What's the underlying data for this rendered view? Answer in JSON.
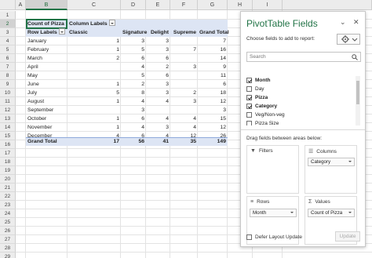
{
  "columns": [
    "A",
    "B",
    "C",
    "D",
    "E",
    "F",
    "G",
    "H",
    "I"
  ],
  "rows": [
    "1",
    "2",
    "3",
    "4",
    "5",
    "6",
    "7",
    "8",
    "9",
    "10",
    "11",
    "12",
    "13",
    "14",
    "15",
    "16",
    "17",
    "18",
    "19",
    "20",
    "21",
    "22",
    "23",
    "24",
    "25",
    "26",
    "27",
    "28",
    "29"
  ],
  "selected_column": "B",
  "selected_row": "2",
  "pivot": {
    "values_label": "Count of Pizza",
    "column_labels": "Column Labels",
    "row_labels": "Row Labels",
    "headers": [
      "Classic",
      "Signature",
      "Delight",
      "Supreme",
      "Grand Total"
    ],
    "data_rows": [
      {
        "label": "January",
        "vals": [
          "1",
          "3",
          "3",
          "",
          "7"
        ]
      },
      {
        "label": "February",
        "vals": [
          "1",
          "5",
          "3",
          "7",
          "16"
        ]
      },
      {
        "label": "March",
        "vals": [
          "2",
          "6",
          "6",
          "",
          "14"
        ]
      },
      {
        "label": "April",
        "vals": [
          "",
          "4",
          "2",
          "3",
          "9"
        ]
      },
      {
        "label": "May",
        "vals": [
          "",
          "5",
          "6",
          "",
          "11"
        ]
      },
      {
        "label": "June",
        "vals": [
          "1",
          "2",
          "3",
          "",
          "6"
        ]
      },
      {
        "label": "July",
        "vals": [
          "5",
          "8",
          "3",
          "2",
          "18"
        ]
      },
      {
        "label": "August",
        "vals": [
          "1",
          "4",
          "4",
          "3",
          "12"
        ]
      },
      {
        "label": "September",
        "vals": [
          "",
          "3",
          "",
          "",
          "3"
        ]
      },
      {
        "label": "October",
        "vals": [
          "1",
          "6",
          "4",
          "4",
          "15"
        ]
      },
      {
        "label": "November",
        "vals": [
          "1",
          "4",
          "3",
          "4",
          "12"
        ]
      },
      {
        "label": "December",
        "vals": [
          "4",
          "6",
          "4",
          "12",
          "26"
        ]
      }
    ],
    "total_label": "Grand Total",
    "totals": [
      "17",
      "56",
      "41",
      "35",
      "149"
    ]
  },
  "pane": {
    "title": "PivotTable Fields",
    "choose_text": "Choose fields to add to report:",
    "search_placeholder": "Search",
    "fields": [
      {
        "name": "Month",
        "checked": true,
        "bold": true
      },
      {
        "name": "Day",
        "checked": false,
        "bold": false
      },
      {
        "name": "Pizza",
        "checked": true,
        "bold": true
      },
      {
        "name": "Category",
        "checked": true,
        "bold": true
      },
      {
        "name": "Veg/Non-veg",
        "checked": false,
        "bold": false
      },
      {
        "name": "Pizza Size",
        "checked": false,
        "bold": false
      }
    ],
    "drag_text": "Drag fields between areas below:",
    "areas": {
      "filters": {
        "label": "Filters",
        "chip": ""
      },
      "columns": {
        "label": "Columns",
        "chip": "Category"
      },
      "rows": {
        "label": "Rows",
        "chip": "Month"
      },
      "values": {
        "label": "Values",
        "chip": "Count of Pizza"
      }
    },
    "defer_label": "Defer Layout Update",
    "update_label": "Update",
    "accent": "#217346"
  }
}
